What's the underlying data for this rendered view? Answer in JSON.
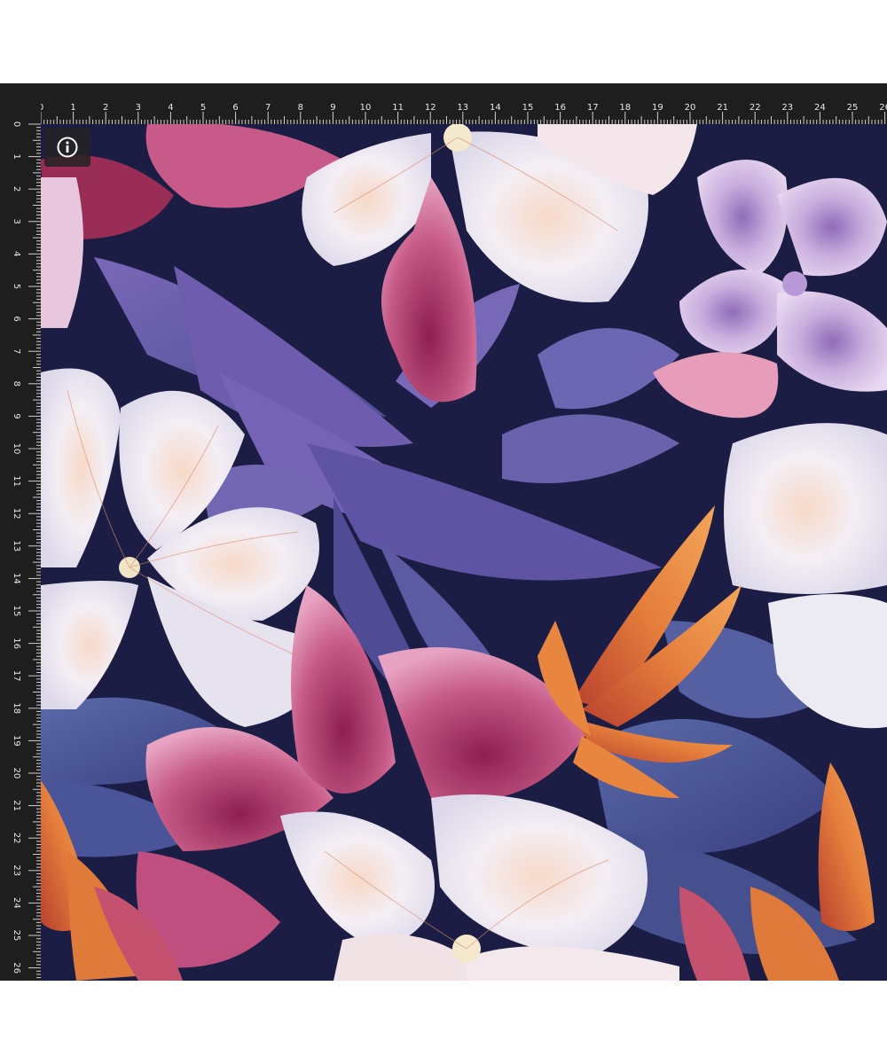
{
  "ruler": {
    "unit": "cm",
    "top_labels": [
      "0",
      "1",
      "2",
      "3",
      "4",
      "5",
      "6",
      "7",
      "8",
      "9",
      "10",
      "11",
      "12",
      "13",
      "14",
      "15",
      "16",
      "17",
      "18",
      "19",
      "20",
      "21",
      "22",
      "23",
      "24",
      "25",
      "26"
    ],
    "left_labels": [
      "0",
      "1",
      "2",
      "3",
      "4",
      "5",
      "6",
      "7",
      "8",
      "9",
      "10",
      "11",
      "12",
      "13",
      "14",
      "15",
      "16",
      "17",
      "18",
      "19",
      "20",
      "21",
      "22",
      "23",
      "24",
      "25",
      "26"
    ]
  },
  "info_button": {
    "icon": "info-icon"
  },
  "pattern": {
    "description_icon": "floral-pattern-image",
    "colors": {
      "background": "#1b1d44",
      "leaf_purple": "#6a5aa8",
      "leaf_blue": "#4c5a9a",
      "petal_white": "#f2ecf2",
      "petal_pink": "#c8557f",
      "petal_lilac": "#c8a8de",
      "bird_orange": "#e8853f",
      "ruler_bg": "#1e1e1e"
    }
  }
}
